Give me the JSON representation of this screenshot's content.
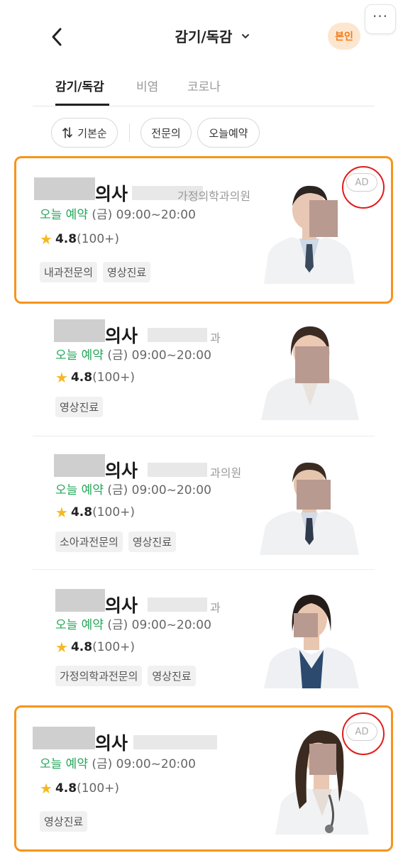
{
  "header": {
    "title": "감기/독감",
    "self_badge": "본인"
  },
  "tabs": [
    {
      "label": "감기/독감",
      "active": true
    },
    {
      "label": "비염",
      "active": false
    },
    {
      "label": "코로나",
      "active": false
    }
  ],
  "filters": {
    "sort": "기본순",
    "chips": [
      "전문의",
      "오늘예약"
    ]
  },
  "doctors": [
    {
      "name_suffix": "의사",
      "hospital": "가정의학과의원",
      "availability_label": "오늘 예약",
      "hours": "(금) 09:00~20:00",
      "rating": "4.8",
      "reviews": "(100+)",
      "tags": [
        "내과전문의",
        "영상진료"
      ],
      "ad": "AD"
    },
    {
      "name_suffix": "의사",
      "hospital": "과",
      "availability_label": "오늘 예약",
      "hours": "(금) 09:00~20:00",
      "rating": "4.8",
      "reviews": "(100+)",
      "tags": [
        "영상진료"
      ]
    },
    {
      "name_suffix": "의사",
      "hospital": "과의원",
      "availability_label": "오늘 예약",
      "hours": "(금) 09:00~20:00",
      "rating": "4.8",
      "reviews": "(100+)",
      "tags": [
        "소아과전문의",
        "영상진료"
      ]
    },
    {
      "name_suffix": "의사",
      "hospital": "과",
      "availability_label": "오늘 예약",
      "hours": "(금) 09:00~20:00",
      "rating": "4.8",
      "reviews": "(100+)",
      "tags": [
        "가정의학과전문의",
        "영상진료"
      ]
    },
    {
      "name_suffix": "의사",
      "hospital": "",
      "availability_label": "오늘 예약",
      "hours": "(금) 09:00~20:00",
      "rating": "4.8",
      "reviews": "(100+)",
      "tags": [
        "영상진료"
      ],
      "ad": "AD"
    }
  ],
  "colors": {
    "accent": "#f7941d",
    "available_green": "#26a65b",
    "star": "#f5b921",
    "ad_highlight": "#e31b1b"
  }
}
